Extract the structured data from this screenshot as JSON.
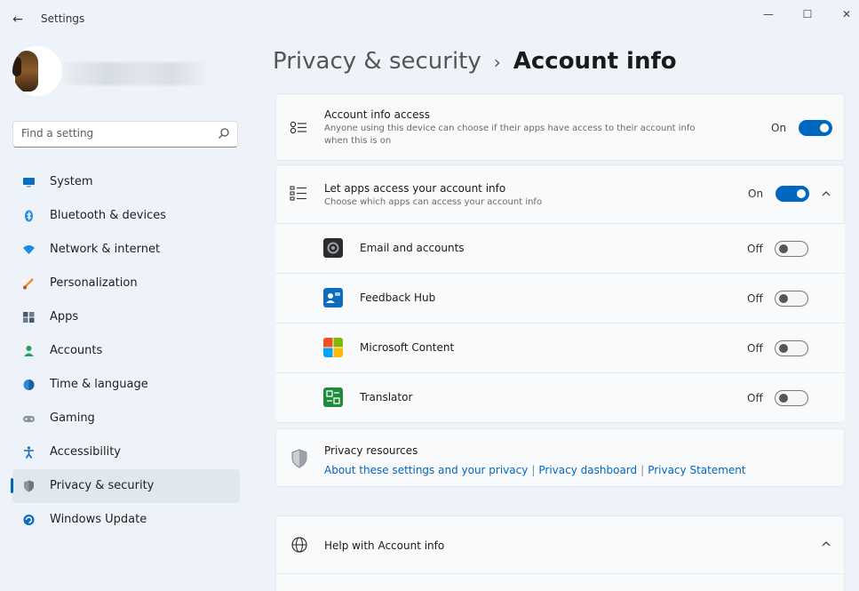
{
  "window": {
    "title": "Settings",
    "back": "←",
    "minimize": "—",
    "maximize": "☐",
    "close": "✕"
  },
  "search": {
    "placeholder": "Find a setting"
  },
  "sidebar": {
    "items": [
      {
        "label": "System",
        "icon": "monitor-icon"
      },
      {
        "label": "Bluetooth & devices",
        "icon": "bluetooth-icon"
      },
      {
        "label": "Network & internet",
        "icon": "wifi-icon"
      },
      {
        "label": "Personalization",
        "icon": "brush-icon"
      },
      {
        "label": "Apps",
        "icon": "apps-icon"
      },
      {
        "label": "Accounts",
        "icon": "person-icon"
      },
      {
        "label": "Time & language",
        "icon": "globe-clock-icon"
      },
      {
        "label": "Gaming",
        "icon": "gamepad-icon"
      },
      {
        "label": "Accessibility",
        "icon": "accessibility-icon"
      },
      {
        "label": "Privacy & security",
        "icon": "shield-icon",
        "active": true
      },
      {
        "label": "Windows Update",
        "icon": "update-icon"
      }
    ]
  },
  "breadcrumb": {
    "parent": "Privacy & security",
    "separator": "›",
    "current": "Account info"
  },
  "account_access": {
    "title": "Account info access",
    "description": "Anyone using this device can choose if their apps have access to their account info when this is on",
    "state": "On"
  },
  "apps_access": {
    "title": "Let apps access your account info",
    "description": "Choose which apps can access your account info",
    "state": "On",
    "apps": [
      {
        "name": "Email and accounts",
        "state": "Off",
        "icon": "mail-app-icon"
      },
      {
        "name": "Feedback Hub",
        "state": "Off",
        "icon": "feedback-hub-icon"
      },
      {
        "name": "Microsoft Content",
        "state": "Off",
        "icon": "microsoft-logo-icon"
      },
      {
        "name": "Translator",
        "state": "Off",
        "icon": "translator-icon"
      }
    ]
  },
  "privacy_resources": {
    "title": "Privacy resources",
    "links": [
      "About these settings and your privacy",
      "Privacy dashboard",
      "Privacy Statement"
    ],
    "separator": "|"
  },
  "help": {
    "title": "Help with Account info"
  },
  "colors": {
    "accent": "#0067c0",
    "background": "#eef3f9",
    "card": "#f9fafb"
  }
}
